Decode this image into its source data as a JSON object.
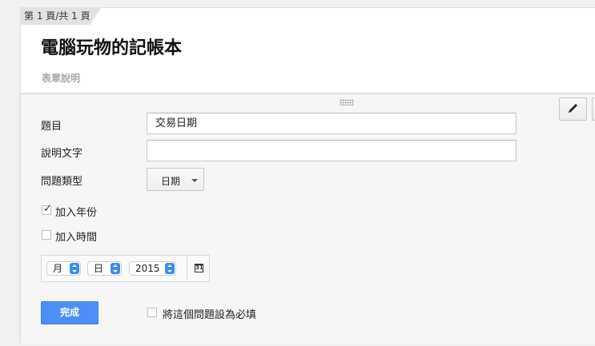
{
  "page_tab": "第 1 頁/共 1 頁",
  "form": {
    "title": "電腦玩物的記帳本",
    "description_placeholder": "表單說明"
  },
  "question_editor": {
    "title_label": "題目",
    "title_value": "交易日期",
    "help_label": "說明文字",
    "help_value": "",
    "type_label": "問題類型",
    "type_value": "日期",
    "include_year_label": "加入年份",
    "include_year_checked": true,
    "include_time_label": "加入時間",
    "include_time_checked": false,
    "preview": {
      "month": "月",
      "day": "日",
      "year": "2015",
      "calendar_day": "31"
    },
    "done_label": "完成",
    "required_label": "將這個問題設為必填",
    "required_checked": false
  },
  "icons": [
    "pencil-icon",
    "calendar-icon",
    "drag-handle-icon",
    "chevron-down-icon"
  ],
  "colors": {
    "accent": "#4d8ff7",
    "select_arrow": "#3b8bef"
  }
}
